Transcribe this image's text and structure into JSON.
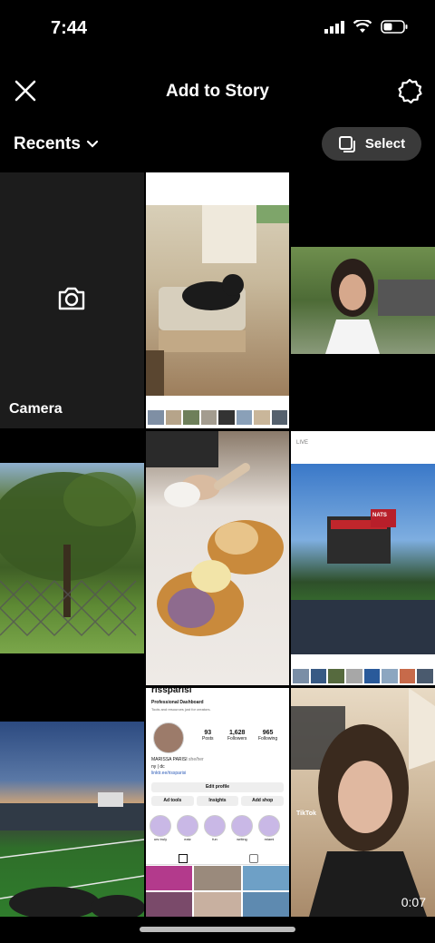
{
  "status": {
    "time": "7:44"
  },
  "header": {
    "title": "Add to Story"
  },
  "toolbar": {
    "recents_label": "Recents",
    "select_label": "Select"
  },
  "camera": {
    "label": "Camera"
  },
  "tiles": {
    "video_duration": "0:07",
    "live_label": "LIVE",
    "stadium_sign": "NATS",
    "tiktok_label": "TikTok"
  },
  "profile_screenshot": {
    "username": "rissparisi",
    "dashboard": "Professional Dashboard",
    "dashboard_sub": "Tools and resources just for creators.",
    "posts_count": "93",
    "posts_label": "Posts",
    "followers_count": "1,628",
    "followers_label": "Followers",
    "following_count": "965",
    "following_label": "Following",
    "name": "MARISSA PARISI",
    "pronouns": "she/her",
    "bio1": "ny | dc",
    "link": "linktr.ee/rissparisi",
    "edit_profile": "Edit profile",
    "ad_tools": "Ad tools",
    "insights": "Insights",
    "add_shop": "Add shop",
    "highlights": [
      "urs truly",
      "eatz",
      "fun",
      "writing",
      "miami"
    ]
  },
  "colors": {
    "background": "#000000",
    "select_bg": "#3a3a3a",
    "camera_bg": "#1c1c1c"
  }
}
